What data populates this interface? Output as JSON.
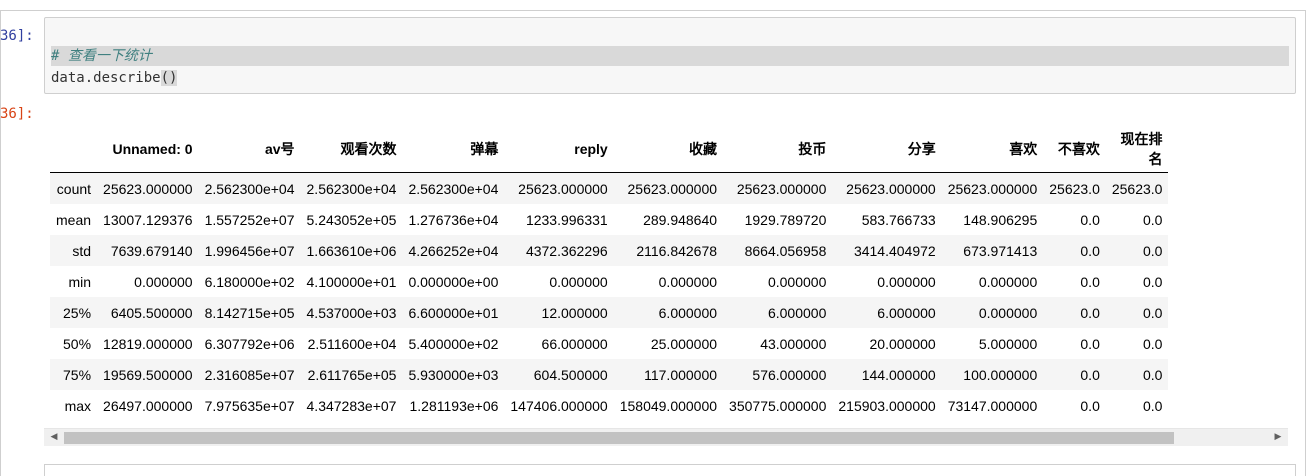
{
  "cell": {
    "input_prompt": "36]:",
    "output_prompt": "36]:",
    "code_comment": "# 查看一下统计",
    "code_prefix": "data.describe",
    "code_parens": "()"
  },
  "table": {
    "columns": [
      "Unnamed: 0",
      "av号",
      "观看次数",
      "弹幕",
      "reply",
      "收藏",
      "投币",
      "分享",
      "喜欢",
      "不喜欢",
      "现在排名"
    ],
    "rows": [
      {
        "label": "count",
        "values": [
          "25623.000000",
          "2.562300e+04",
          "2.562300e+04",
          "2.562300e+04",
          "25623.000000",
          "25623.000000",
          "25623.000000",
          "25623.000000",
          "25623.000000",
          "25623.0",
          "25623.0"
        ]
      },
      {
        "label": "mean",
        "values": [
          "13007.129376",
          "1.557252e+07",
          "5.243052e+05",
          "1.276736e+04",
          "1233.996331",
          "289.948640",
          "1929.789720",
          "583.766733",
          "148.906295",
          "0.0",
          "0.0"
        ]
      },
      {
        "label": "std",
        "values": [
          "7639.679140",
          "1.996456e+07",
          "1.663610e+06",
          "4.266252e+04",
          "4372.362296",
          "2116.842678",
          "8664.056958",
          "3414.404972",
          "673.971413",
          "0.0",
          "0.0"
        ]
      },
      {
        "label": "min",
        "values": [
          "0.000000",
          "6.180000e+02",
          "4.100000e+01",
          "0.000000e+00",
          "0.000000",
          "0.000000",
          "0.000000",
          "0.000000",
          "0.000000",
          "0.0",
          "0.0"
        ]
      },
      {
        "label": "25%",
        "values": [
          "6405.500000",
          "8.142715e+05",
          "4.537000e+03",
          "6.600000e+01",
          "12.000000",
          "6.000000",
          "6.000000",
          "6.000000",
          "0.000000",
          "0.0",
          "0.0"
        ]
      },
      {
        "label": "50%",
        "values": [
          "12819.000000",
          "6.307792e+06",
          "2.511600e+04",
          "5.400000e+02",
          "66.000000",
          "25.000000",
          "43.000000",
          "20.000000",
          "5.000000",
          "0.0",
          "0.0"
        ]
      },
      {
        "label": "75%",
        "values": [
          "19569.500000",
          "2.316085e+07",
          "2.611765e+05",
          "5.930000e+03",
          "604.500000",
          "117.000000",
          "576.000000",
          "144.000000",
          "100.000000",
          "0.0",
          "0.0"
        ]
      },
      {
        "label": "max",
        "values": [
          "26497.000000",
          "7.975635e+07",
          "4.347283e+07",
          "1.281193e+06",
          "147406.000000",
          "158049.000000",
          "350775.000000",
          "215903.000000",
          "73147.000000",
          "0.0",
          "0.0"
        ]
      }
    ]
  },
  "scrollbar": {
    "left_arrow_icon": "triangle-left-icon",
    "right_arrow_icon": "triangle-right-icon"
  }
}
